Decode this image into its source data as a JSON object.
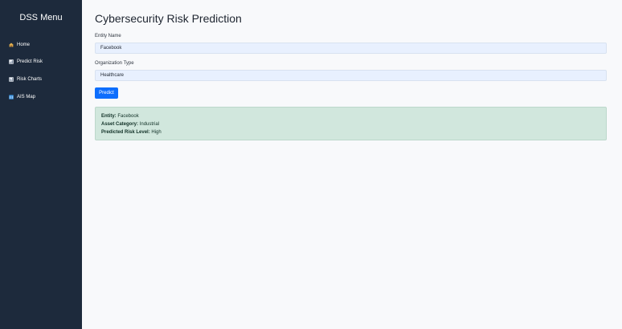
{
  "sidebar": {
    "title": "DSS Menu",
    "items": [
      {
        "label": "Home",
        "icon": "home-icon"
      },
      {
        "label": "Predict Risk",
        "icon": "predict-risk-icon"
      },
      {
        "label": "Risk Charts",
        "icon": "risk-charts-icon"
      },
      {
        "label": "AIS Map",
        "icon": "map-icon"
      }
    ]
  },
  "main": {
    "title": "Cybersecurity Risk Prediction",
    "form": {
      "entity_name": {
        "label": "Entity Name",
        "value": "Facebook"
      },
      "organization_type": {
        "label": "Organization Type",
        "value": "Healthcare"
      },
      "submit_label": "Predict"
    },
    "result": {
      "entity_label": "Entity:",
      "entity_value": "Facebook",
      "asset_category_label": "Asset Category:",
      "asset_category_value": "Industrial",
      "risk_label": "Predicted Risk Level:",
      "risk_value": "High"
    }
  },
  "colors": {
    "sidebar_background": "#1d2a3c",
    "page_background": "#f8f9fb",
    "field_background": "#e8f0fe",
    "button_blue": "#0d6efd",
    "success_background": "#d1e7dd"
  }
}
